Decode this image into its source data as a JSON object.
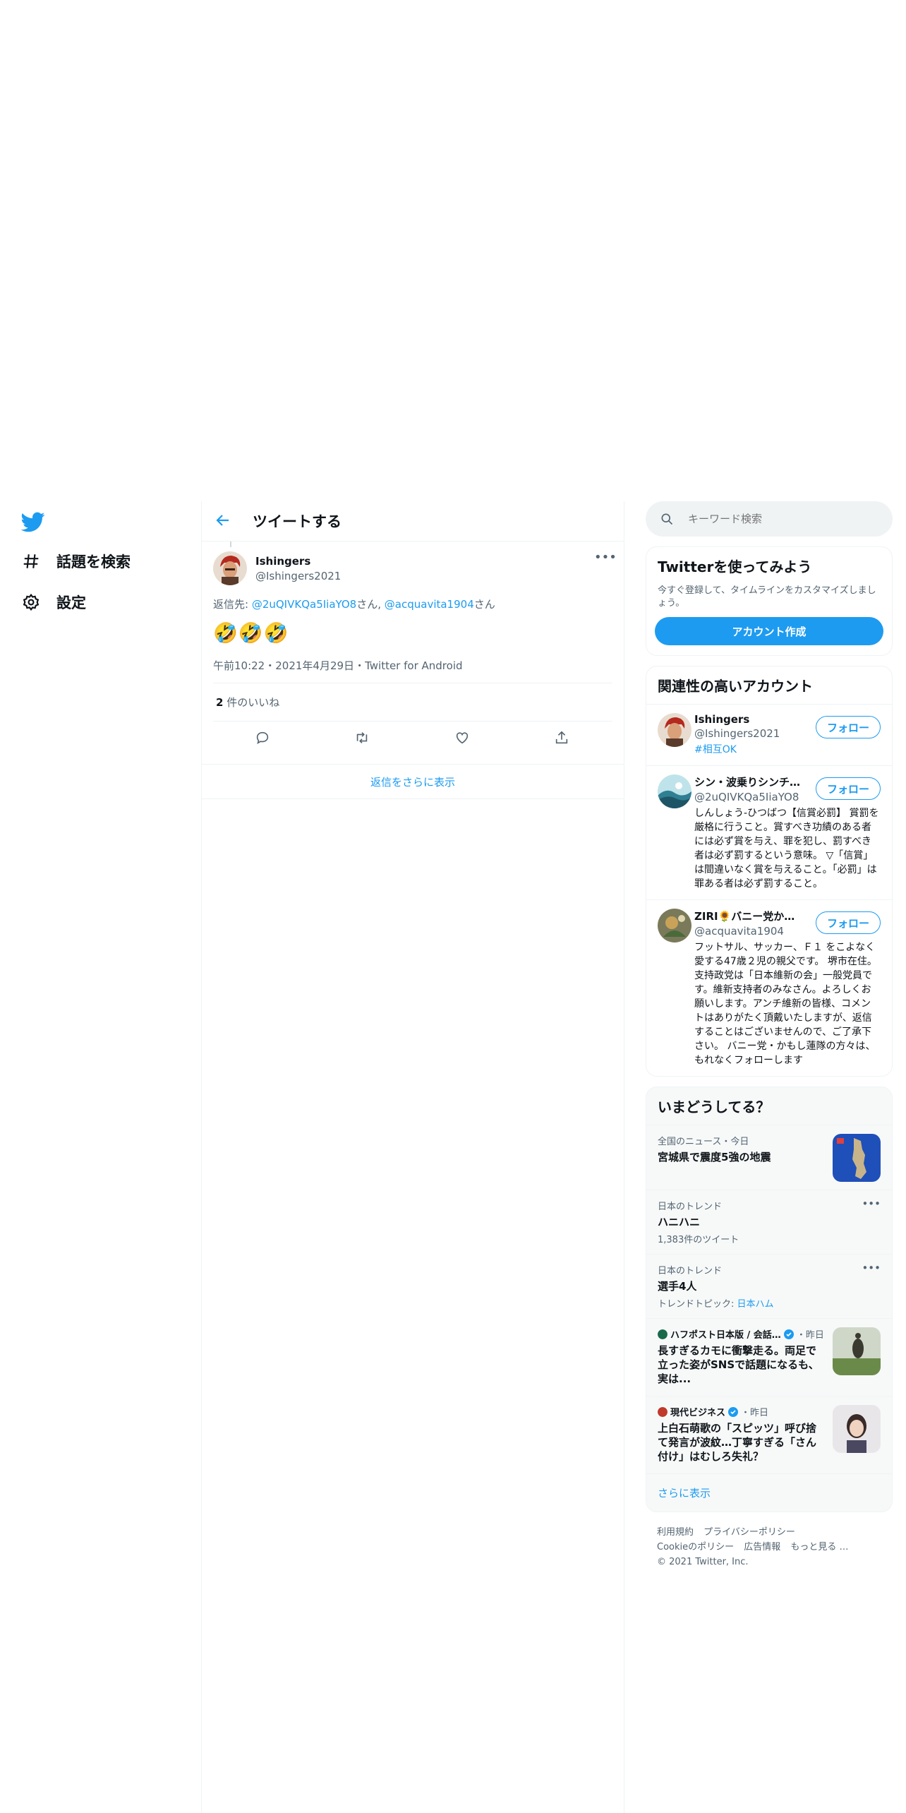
{
  "nav": {
    "items": [
      {
        "label": "話題を検索",
        "icon": "hashtag-icon"
      },
      {
        "label": "設定",
        "icon": "gear-icon"
      }
    ]
  },
  "header": {
    "title": "ツイートする"
  },
  "tweet": {
    "author_name": "Ishingers",
    "author_handle": "@Ishingers2021",
    "reply_prefix": "返信先: ",
    "mention1": "@2uQIVKQa5IiaYO8",
    "suffix1": "さん, ",
    "mention2": "@acquavita1904",
    "suffix2": "さん",
    "text": "🤣🤣🤣",
    "time": "午前10:22",
    "date": "2021年4月29日",
    "client": "Twitter for Android",
    "likes_count": "2",
    "likes_label": " 件のいいね",
    "show_more_replies": "返信をさらに表示"
  },
  "search": {
    "placeholder": "キーワード検索"
  },
  "signup": {
    "title": "Twitterを使ってみよう",
    "desc": "今すぐ登録して、タイムラインをカスタマイズしましょう。",
    "button": "アカウント作成"
  },
  "relevant": {
    "title": "関連性の高いアカウント",
    "follow_label": "フォロー",
    "accounts": [
      {
        "name": "Ishingers",
        "handle": "@Ishingers2021",
        "bio": "#相互OK"
      },
      {
        "name": "シン・波乗りシンチ…",
        "handle": "@2uQIVKQa5IiaYO8",
        "bio": "しんしょう-ひつばつ【信賞必罰】 賞罰を厳格に行うこと。賞すべき功績のある者には必ず賞を与え、罪を犯し、罰すべき者は必ず罰するという意味。 ▽「信賞」は間違いなく賞を与えること。「必罰」は罪ある者は必ず罰すること。"
      },
      {
        "name": "ZIRI🌻バニー党かも…",
        "handle": "@acquavita1904",
        "bio": "フットサル、サッカー、Ｆ１ をこよなく愛する47歳２児の親父です。 堺市在住。支持政党は「日本維新の会」一般党員です。維新支持者のみなさん。よろしくお願いします。アンチ維新の皆様、コメントはありがたく頂戴いたしますが、返信することはございませんので、ご了承下さい。 バニー党・かもし蓮隊の方々は、もれなくフォローします"
      }
    ]
  },
  "trends": {
    "title": "いまどうしてる？",
    "items": [
      {
        "context": "全国のニュース・今日",
        "title": "宮城県で震度5強の地震"
      },
      {
        "context": "日本のトレンド",
        "title": "ハニハニ",
        "sub": "1,383件のツイート"
      },
      {
        "context": "日本のトレンド",
        "title": "選手4人",
        "sub_prefix": "トレンドトピック: ",
        "sub_link": "日本ハム"
      },
      {
        "source": "ハフポスト日本版 / 会話…",
        "time": "・昨日",
        "title": "長すぎるカモに衝撃走る。両足で立った姿がSNSで話題になるも、実は..."
      },
      {
        "source": "現代ビジネス",
        "time": "・昨日",
        "title": "上白石萌歌の「スピッツ」呼び捨て発言が波紋…丁寧すぎる「さん付け」はむしろ失礼？"
      }
    ],
    "show_more": "さらに表示"
  },
  "footer": {
    "links": [
      "利用規約",
      "プライバシーポリシー",
      "Cookieのポリシー",
      "広告情報",
      "もっと見る …"
    ],
    "copyright": "© 2021 Twitter, Inc."
  },
  "colors": {
    "accent": "#1d9bf0",
    "muted": "#536471",
    "text": "#0f1419",
    "border": "#eff3f4"
  }
}
